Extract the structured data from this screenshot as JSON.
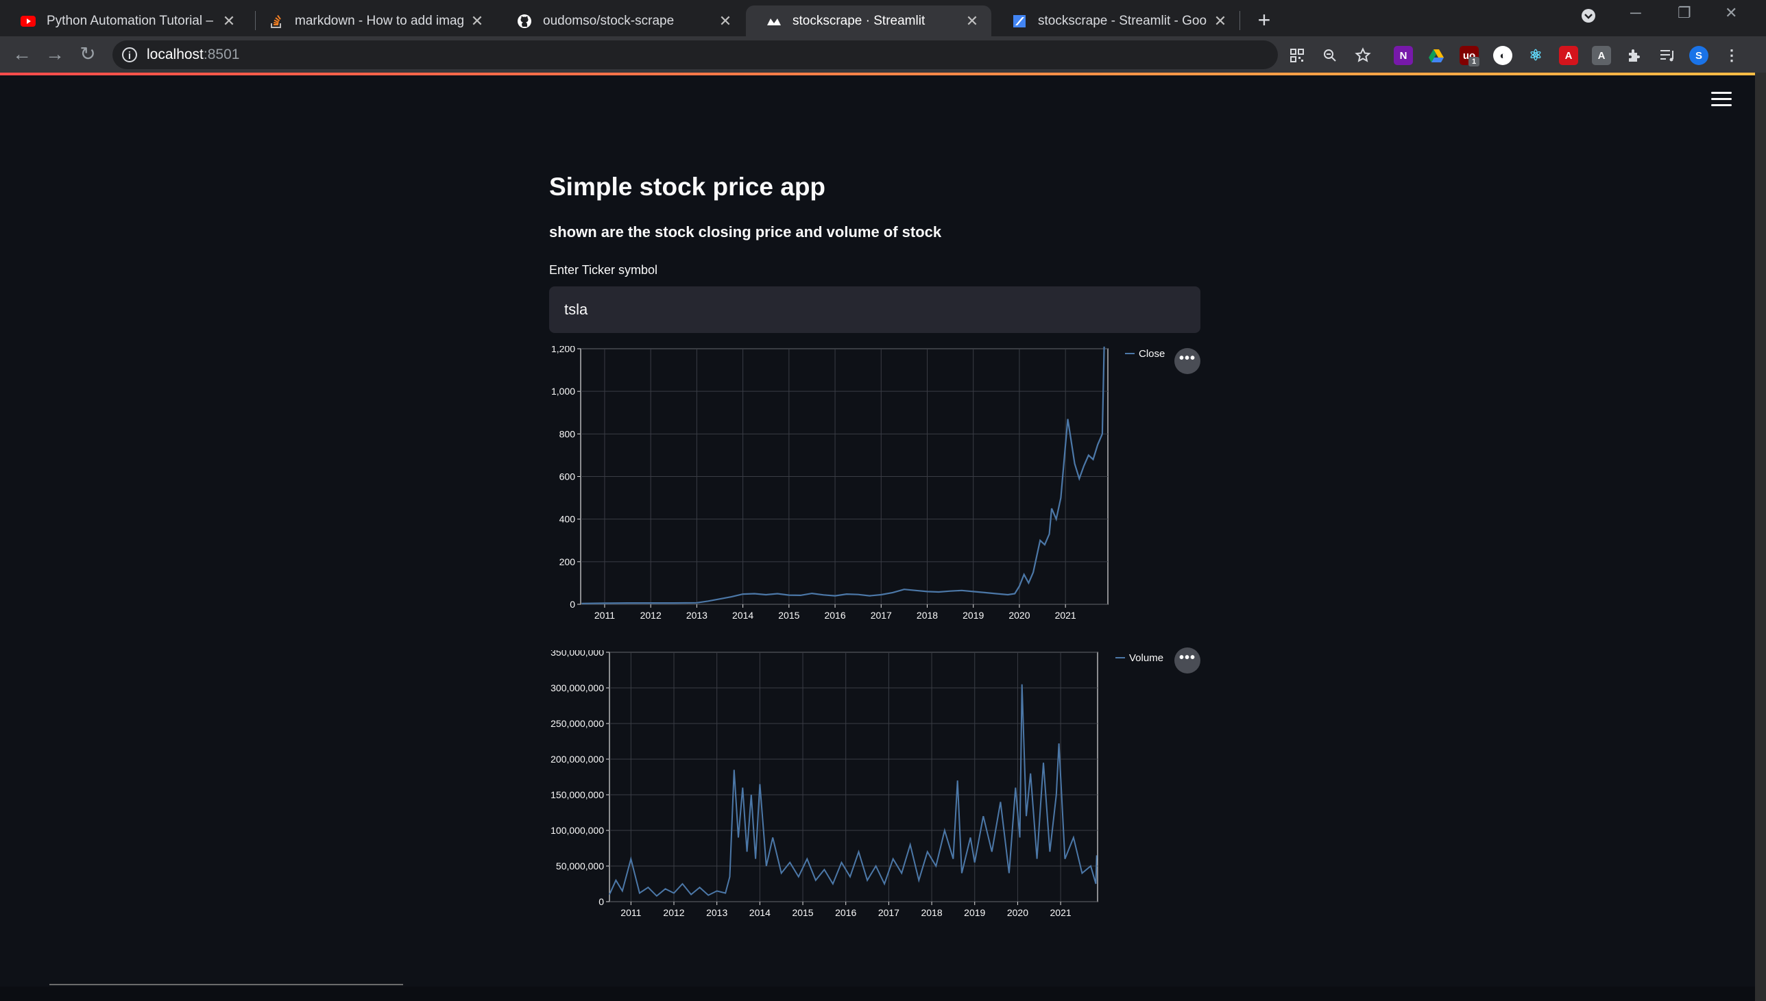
{
  "browser": {
    "tabs": [
      {
        "title": "Python Automation Tutorial – Ho",
        "icon": "youtube-icon"
      },
      {
        "title": "markdown - How to add images",
        "icon": "stackoverflow-icon"
      },
      {
        "title": "oudomso/stock-scrape",
        "icon": "github-icon"
      },
      {
        "title": "stockscrape · Streamlit",
        "icon": "streamlit-icon"
      },
      {
        "title": "stockscrape - Streamlit - Google",
        "icon": "google-cloud-icon"
      }
    ],
    "active_tab": 3,
    "url_host": "localhost",
    "url_port": ":8501",
    "profile_initial": "S",
    "extension_badge": "1"
  },
  "app": {
    "title": "Simple stock price app",
    "subtitle": "shown are the stock closing price and volume of stock",
    "ticker_label": "Enter Ticker symbol",
    "ticker_value": "tsla",
    "menu_glyph": "•••"
  },
  "colors": {
    "accent_gradient_start": "#ff4b4b",
    "accent_gradient_end": "#ffbd45",
    "series": "#4c78a8",
    "background": "#0e1117",
    "input_bg": "#262730"
  },
  "chart_data": [
    {
      "type": "line",
      "legend": [
        "Close"
      ],
      "x_ticks": [
        "2011",
        "2012",
        "2013",
        "2014",
        "2015",
        "2016",
        "2017",
        "2018",
        "2019",
        "2020",
        "2021"
      ],
      "y_ticks": [
        "0",
        "200",
        "400",
        "600",
        "800",
        "1,000",
        "1,200"
      ],
      "ylim": [
        0,
        1200
      ],
      "grid": true,
      "legend_position": "top-right",
      "series": [
        {
          "x": [
            2010.5,
            2011.0,
            2011.5,
            2012.0,
            2012.5,
            2013.0,
            2013.25,
            2013.5,
            2013.75,
            2014.0,
            2014.25,
            2014.5,
            2014.75,
            2015.0,
            2015.25,
            2015.5,
            2015.75,
            2016.0,
            2016.25,
            2016.5,
            2016.75,
            2017.0,
            2017.25,
            2017.5,
            2017.75,
            2018.0,
            2018.25,
            2018.5,
            2018.75,
            2019.0,
            2019.25,
            2019.5,
            2019.75,
            2019.9,
            2020.0,
            2020.1,
            2020.2,
            2020.3,
            2020.45,
            2020.55,
            2020.65,
            2020.7,
            2020.8,
            2020.9,
            2021.0,
            2021.05,
            2021.1,
            2021.2,
            2021.3,
            2021.4,
            2021.5,
            2021.6,
            2021.7,
            2021.8,
            2021.84
          ],
          "y": [
            4,
            5,
            6,
            6,
            6,
            7,
            15,
            25,
            35,
            48,
            50,
            45,
            50,
            43,
            42,
            51,
            44,
            40,
            48,
            46,
            40,
            45,
            55,
            70,
            65,
            60,
            58,
            62,
            65,
            60,
            55,
            50,
            45,
            50,
            85,
            140,
            100,
            150,
            300,
            280,
            330,
            450,
            400,
            500,
            750,
            870,
            800,
            660,
            590,
            650,
            700,
            680,
            750,
            800,
            1210
          ]
        }
      ]
    },
    {
      "type": "line",
      "legend": [
        "Volume"
      ],
      "x_ticks": [
        "2011",
        "2012",
        "2013",
        "2014",
        "2015",
        "2016",
        "2017",
        "2018",
        "2019",
        "2020",
        "2021"
      ],
      "y_ticks": [
        "0",
        "50,000,000",
        "100,000,000",
        "150,000,000",
        "200,000,000",
        "250,000,000",
        "300,000,000",
        "350,000,000"
      ],
      "ylim": [
        0,
        350000000
      ],
      "grid": true,
      "legend_position": "top-right",
      "series": [
        {
          "x": [
            2010.5,
            2010.65,
            2010.8,
            2011.0,
            2011.2,
            2011.4,
            2011.6,
            2011.8,
            2012.0,
            2012.2,
            2012.4,
            2012.6,
            2012.8,
            2013.0,
            2013.2,
            2013.3,
            2013.4,
            2013.5,
            2013.6,
            2013.7,
            2013.8,
            2013.9,
            2014.0,
            2014.15,
            2014.3,
            2014.5,
            2014.7,
            2014.9,
            2015.1,
            2015.3,
            2015.5,
            2015.7,
            2015.9,
            2016.1,
            2016.3,
            2016.5,
            2016.7,
            2016.9,
            2017.1,
            2017.3,
            2017.5,
            2017.7,
            2017.9,
            2018.1,
            2018.3,
            2018.5,
            2018.6,
            2018.7,
            2018.9,
            2019.0,
            2019.2,
            2019.4,
            2019.6,
            2019.8,
            2019.95,
            2020.05,
            2020.1,
            2020.2,
            2020.3,
            2020.45,
            2020.6,
            2020.75,
            2020.9,
            2020.96,
            2021.1,
            2021.3,
            2021.5,
            2021.7,
            2021.82,
            2021.84
          ],
          "y": [
            10000000,
            30000000,
            15000000,
            60000000,
            12000000,
            20000000,
            8000000,
            18000000,
            12000000,
            25000000,
            10000000,
            20000000,
            9000000,
            15000000,
            12000000,
            35000000,
            185000000,
            90000000,
            160000000,
            70000000,
            150000000,
            60000000,
            165000000,
            50000000,
            90000000,
            40000000,
            55000000,
            35000000,
            60000000,
            30000000,
            45000000,
            25000000,
            55000000,
            35000000,
            70000000,
            30000000,
            50000000,
            25000000,
            60000000,
            40000000,
            80000000,
            30000000,
            70000000,
            50000000,
            100000000,
            60000000,
            170000000,
            40000000,
            90000000,
            55000000,
            120000000,
            70000000,
            140000000,
            40000000,
            160000000,
            90000000,
            305000000,
            120000000,
            180000000,
            60000000,
            195000000,
            70000000,
            150000000,
            222000000,
            60000000,
            90000000,
            40000000,
            50000000,
            25000000,
            65000000
          ]
        }
      ]
    }
  ]
}
